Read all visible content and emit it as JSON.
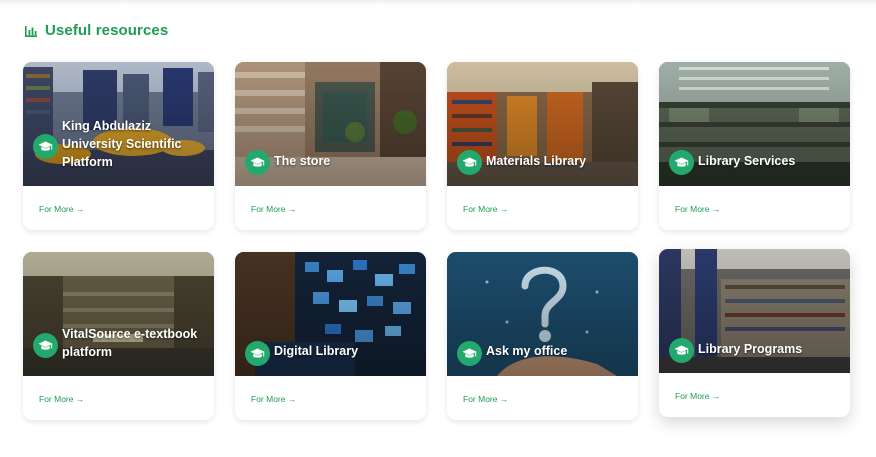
{
  "section": {
    "title": "Useful resources",
    "icon": "bar-chart-icon",
    "accent": "#1f9d55"
  },
  "more_label": "For More →",
  "cards": [
    {
      "title": "King Abdulaziz University Scientific Platform",
      "icon": "graduation-cap-icon"
    },
    {
      "title": "The store",
      "icon": "graduation-cap-icon"
    },
    {
      "title": "Materials Library",
      "icon": "graduation-cap-icon"
    },
    {
      "title": "Library Services",
      "icon": "graduation-cap-icon"
    },
    {
      "title": "VitalSource e-textbook platform",
      "icon": "graduation-cap-icon"
    },
    {
      "title": "Digital Library",
      "icon": "graduation-cap-icon"
    },
    {
      "title": "Ask my office",
      "icon": "graduation-cap-icon"
    },
    {
      "title": "Library Programs",
      "icon": "graduation-cap-icon"
    }
  ]
}
